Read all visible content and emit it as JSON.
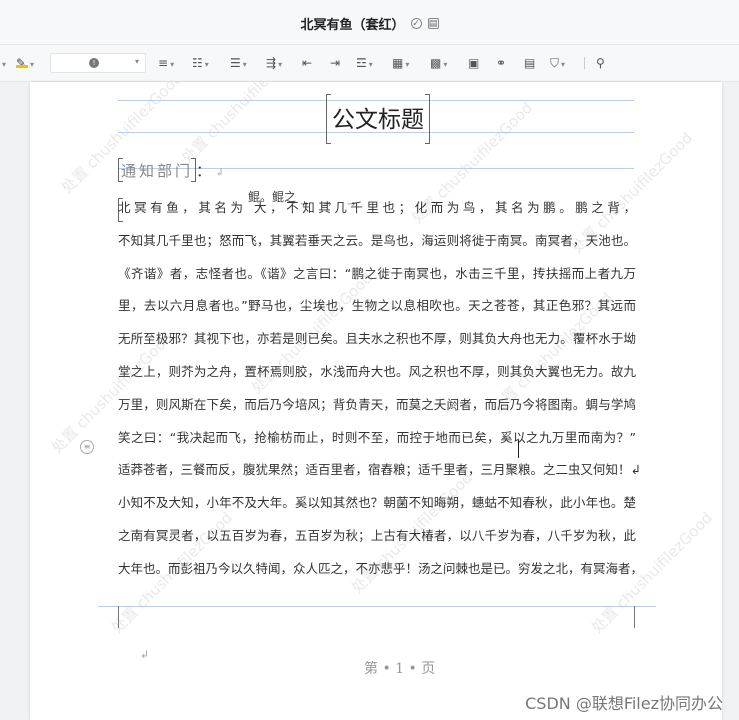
{
  "window": {
    "title": "北冥有鱼（套红）",
    "status_icon": "check-circle-icon",
    "save_icon": "save-icon"
  },
  "toolbar": {
    "items": [
      {
        "name": "prev-caret",
        "glyph": "▾"
      },
      {
        "name": "highlight-color",
        "glyph": "✎",
        "color": "#f2c200"
      },
      {
        "name": "font-size-select",
        "glyph": "●"
      },
      {
        "name": "align",
        "glyph": "≡ ▾"
      },
      {
        "name": "bullet-list",
        "glyph": "⁝≡ ▾"
      },
      {
        "name": "numbered-list",
        "glyph": "⅓≡ ▾"
      },
      {
        "name": "multilevel-list",
        "glyph": "⇉ ▾"
      },
      {
        "name": "indent-decrease",
        "glyph": "⇤"
      },
      {
        "name": "indent-increase",
        "glyph": "⇥"
      },
      {
        "name": "line-spacing",
        "glyph": "☰ ▾"
      },
      {
        "name": "table-border",
        "glyph": "▦ ▾"
      },
      {
        "name": "table-insert",
        "glyph": "▦ ▾"
      },
      {
        "name": "image",
        "glyph": "🖾"
      },
      {
        "name": "link",
        "glyph": "⚯"
      },
      {
        "name": "comment",
        "glyph": "▤"
      },
      {
        "name": "shield",
        "glyph": "⛉ ▾"
      },
      {
        "name": "search",
        "glyph": "⚲"
      }
    ]
  },
  "document": {
    "heading": "公文标题",
    "department": "通知部门",
    "department_colon": "：",
    "return_mark": "↲",
    "inserted_text": "鲲。鲲之",
    "insert_arrows": "→ → →",
    "lines": [
      "北冥有鱼，其名为                              大，不知其几千里也；化而为鸟，其名为鹏。鹏之背，",
      "不知其几千里也；怒而飞，其翼若垂天之云。是鸟也，海运则将徙于南冥。南冥者，天池也。",
      "《齐谐》者，志怪者也。《谐》之言曰：“鹏之徙于南冥也，水击三千里，抟扶摇而上者九万",
      "里，去以六月息者也。”野马也，尘埃也，生物之以息相吹也。天之苍苍，其正色邪？其远而",
      "无所至极邪？其视下也，亦若是则已矣。且夫水之积也不厚，则其负大舟也无力。覆杯水于坳",
      "堂之上，则芥为之舟，置杯焉则胶，水浅而舟大也。风之积也不厚，则其负大翼也无力。故九",
      "万里，则风斯在下矣，而后乃今培风；背负青天，而莫之夭阏者，而后乃今将图南。蜩与学鸠",
      "笑之曰：“我决起而飞，抢榆枋而止，时则不至，而控于地而已矣，奚以之九万里而南为？”",
      "适莽苍者，三餐而反，腹犹果然；适百里者，宿舂粮；适千里者，三月聚粮。之二虫又何知！↲",
      "小知不及大知，小年不及大年。奚以知其然也？朝菌不知晦朔，蟪蛄不知春秋，此小年也。楚",
      "之南有冥灵者，以五百岁为春，五百岁为秋；上古有大椿者，以八千岁为春，八千岁为秋，此",
      "大年也。而彭祖乃今以久特闻，众人匹之，不亦悲乎！汤之问棘也是已。穷发之北，有冥海者，"
    ],
    "page_number": "第 • 1 • 页",
    "watermark_text": "处置 chushuifilezGood"
  },
  "credit": "CSDN @联想Filez协同办公"
}
